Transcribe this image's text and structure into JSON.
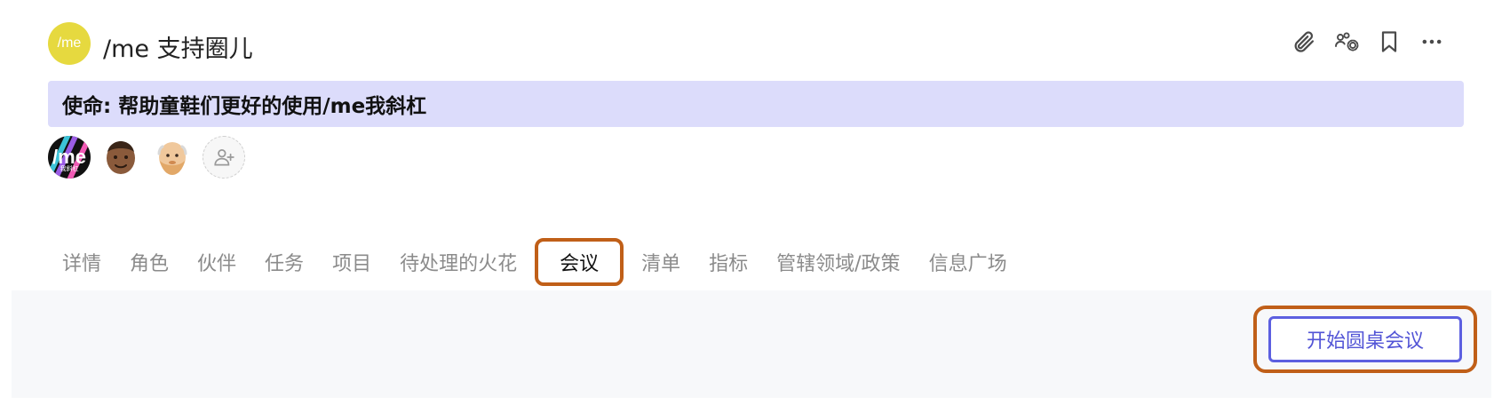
{
  "header": {
    "logo_text": "/me",
    "title": "/me 支持圈儿",
    "tools": [
      {
        "icon": "paperclip-icon"
      },
      {
        "icon": "group-settings-icon"
      },
      {
        "icon": "bookmark-icon"
      },
      {
        "icon": "more-icon",
        "label": "···"
      }
    ]
  },
  "mission": {
    "text": "使命: 帮助童鞋们更好的使用/me我斜杠"
  },
  "members": [
    {
      "kind": "logo",
      "text": "/me",
      "sub": "我斜杠"
    },
    {
      "kind": "avatar",
      "skin": "#8a5a3b"
    },
    {
      "kind": "avatar",
      "skin": "#e2a868"
    },
    {
      "kind": "add",
      "icon": "add-person-icon"
    }
  ],
  "tabs": [
    {
      "label": "详情",
      "active": false
    },
    {
      "label": "角色",
      "active": false
    },
    {
      "label": "伙伴",
      "active": false
    },
    {
      "label": "任务",
      "active": false
    },
    {
      "label": "项目",
      "active": false
    },
    {
      "label": "待处理的火花",
      "active": false
    },
    {
      "label": "会议",
      "active": true
    },
    {
      "label": "清单",
      "active": false
    },
    {
      "label": "指标",
      "active": false
    },
    {
      "label": "管辖领域/政策",
      "active": false
    },
    {
      "label": "信息广场",
      "active": false
    }
  ],
  "panel": {
    "start_button": "开始圆桌会议"
  },
  "colors": {
    "logo_bg": "#e6d93f",
    "mission_bg": "#dcdcfb",
    "highlight": "#c05f18",
    "primary": "#5c5fe0"
  }
}
